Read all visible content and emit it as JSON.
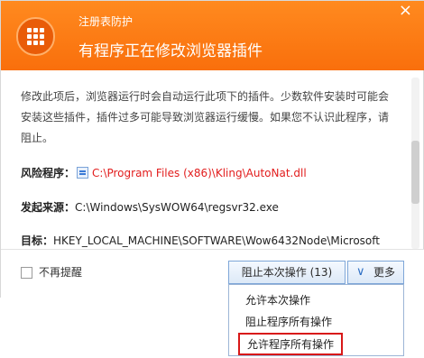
{
  "header": {
    "subtitle": "注册表防护",
    "title": "有程序正在修改浏览器插件"
  },
  "content": {
    "description": "修改此项后，浏览器运行时会自动运行此项下的插件。少数软件安装时可能会安装这些插件，插件过多可能导致浏览器运行缓慢。如果您不认识此程序，请阻止。",
    "risk_label": "风险程序：",
    "risk_value": "C:\\Program Files (x86)\\Kling\\AutoNat.dll",
    "source_label": "发起来源：",
    "source_value": "C:\\Windows\\SysWOW64\\regsvr32.exe",
    "target_label": "目标：",
    "target_value": "HKEY_LOCAL_MACHINE\\SOFTWARE\\Wow6432Node\\Microsoft"
  },
  "footer": {
    "no_remind_label": "不再提醒",
    "block_button_label": "阻止本次操作 (13)",
    "more_button_label": "更多"
  },
  "menu": {
    "items": [
      "允许本次操作",
      "阻止程序所有操作",
      "允许程序所有操作"
    ]
  },
  "colors": {
    "header_orange": "#f97a12",
    "risk_red": "#e21d1d",
    "highlight_red": "#d81818"
  },
  "icons": [
    "shield-grid-icon",
    "close-icon",
    "file-icon",
    "chevron-down-icon"
  ]
}
